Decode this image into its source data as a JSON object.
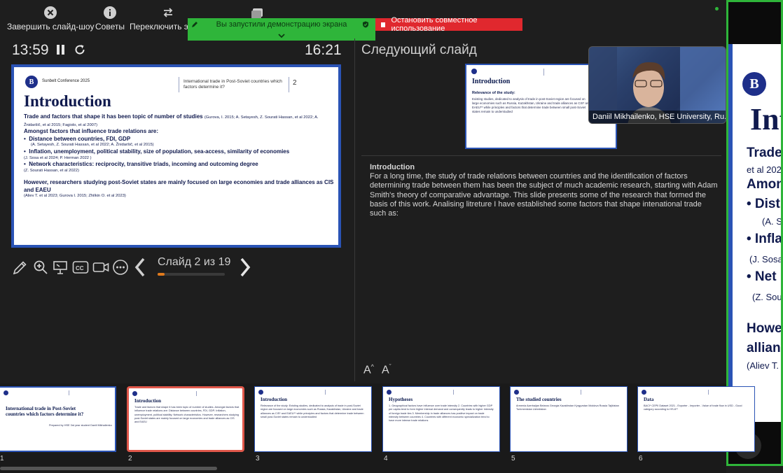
{
  "toolbar": {
    "end_slideshow": "Завершить слайд-шоу",
    "tips": "Советы",
    "switch": "Переключить эк"
  },
  "share": {
    "started_text": "Вы запустили демонстрацию экрана",
    "stop_text": "Остановить совместное использование"
  },
  "timer": {
    "elapsed": "13:59",
    "clock": "16:21"
  },
  "next_slide_label": "Следующий слайд",
  "current_slide": {
    "conference": "Sunbelt Conference 2025",
    "header": "International trade in Post-Soviet countries which factors determine it?",
    "page": "2",
    "title": "Introduction",
    "line1": "Trade and factors that shape it has been topic of number of studies",
    "line1_refs": "(Gurova, I. 2015; A. Setayesh, Z. Sourati Hassan, et al 2022; A. Žnidaršič, et al 2015; Fagiolo, et al 2007)",
    "line2": "Amongst factors that influence trade relations are:",
    "bullet1": "Distance between countries, FDI, GDP",
    "bullet1_refs": "(A. Setayesh, Z. Sourati Hassan, et al 2022; A. Žnidaršič, et al 2015)",
    "bullet2": "Inflation, unemployment, political stability, size of population, sea-access, similarity of economies",
    "bullet2_refs": "(J. Sosa et al 2024; P. Herman 2022 )",
    "bullet3": "Network characteristics: reciprocity, transitive triads, incoming and outcoming degree",
    "bullet3_refs": "(Z. Sourati Hassan, et al 2022)",
    "para2": "However, researchers studying post-Soviet states are mainly focused on large economies and trade alliances as CIS and EAEU",
    "para2_refs": "(Aliev T. et al 2023; Gurova I. 2015; Zhilkin O. et al 2023)"
  },
  "controls": {
    "slide_counter": "Слайд 2 из 19",
    "progress": 0.105
  },
  "next_slide": {
    "title": "Introduction",
    "subtitle": "Relevance of the study:",
    "text": "Existing studies, dedicated to analysis of trade in post-Soviet region are focused on large economies such as Russia, Kazakhstan, Ukraine and trade alliances as CIS* and EAEU** while principles and factors that determine trade between small post-Soviet states remain to understudied"
  },
  "camera": {
    "name": "Daniil Mikhailenko, HSE University, Ru..."
  },
  "notes": {
    "heading": "Introduction",
    "body": "For a long time, the study of trade relations between countries and the identification of factors determining trade between them has been the subject of much academic research, starting with Adam Smith's theory of comparative advantage. This slide presents some of the research that formed the basis of this work. Analising litreture I have established some factors that shape intenational trade such as:"
  },
  "font_controls": {
    "increase": "A",
    "decrease": "A"
  },
  "shared_screen": {
    "title_fragment": "Int",
    "row1": "Trade",
    "row2": "et al 202",
    "row3": "Among",
    "row4": "• Dist",
    "row5": "(A. S",
    "row6": "• Infla",
    "row7": "(J. Sosa",
    "row8": "• Net",
    "row9": "(Z. Sour",
    "row10": "Howe",
    "row11": "allianc",
    "row12": "(Aliev T."
  },
  "thumbnails": [
    {
      "num": "1",
      "title": "International trade in Post-Soviet countries which factors determine it?",
      "lines": "Prepared by HSE 3rd year student Daniil Mikhailenko"
    },
    {
      "num": "2",
      "title": "Introduction",
      "lines": "Trade and factors that shape it has been topic of number of studies. Amongst factors that influence trade relations are: Distance between countries, FDI, GDP; Inflation, unemployment, political stability; Network characteristics. However, researchers studying post-Soviet states are mainly focused on large economies and trade alliances as CIS and EAEU"
    },
    {
      "num": "3",
      "title": "Introduction",
      "lines": "Relevance of the study: Existing studies, dedicated to analysis of trade in post-Soviet region are focused on large economies such as Russia, Kazakhstan, Ukraine and trade alliances as CIS* and EAEU** while principles and factors that determine trade between small post-Soviet states remain to understudied"
    },
    {
      "num": "4",
      "title": "Hypotheses",
      "lines": "1. Geographical factors have influence over trade intensity 2. Countries with higher GDP per capita tend to form higher internal demand and consequently leads to higher intensity of foreign trade ties 3. Membership in trade alliances has positive impact on trade intensity between countries 4. Countries with different economic specialization tend to have more intense trade relations"
    },
    {
      "num": "5",
      "title": "The studied countries",
      "lines": "Armenia  Azerbaijan  Belarus  Georgia  Kazakhstan  Kyrgyzstan  Moldova  Russia  Tajikistan  Turkmenistan  Uzbekistan"
    },
    {
      "num": "6",
      "title": "Data",
      "lines": "BACI* CEPII Dataset 2021 - Exporter - Importer - Value of trade flow in USD - Good category according to HS-6**"
    }
  ]
}
